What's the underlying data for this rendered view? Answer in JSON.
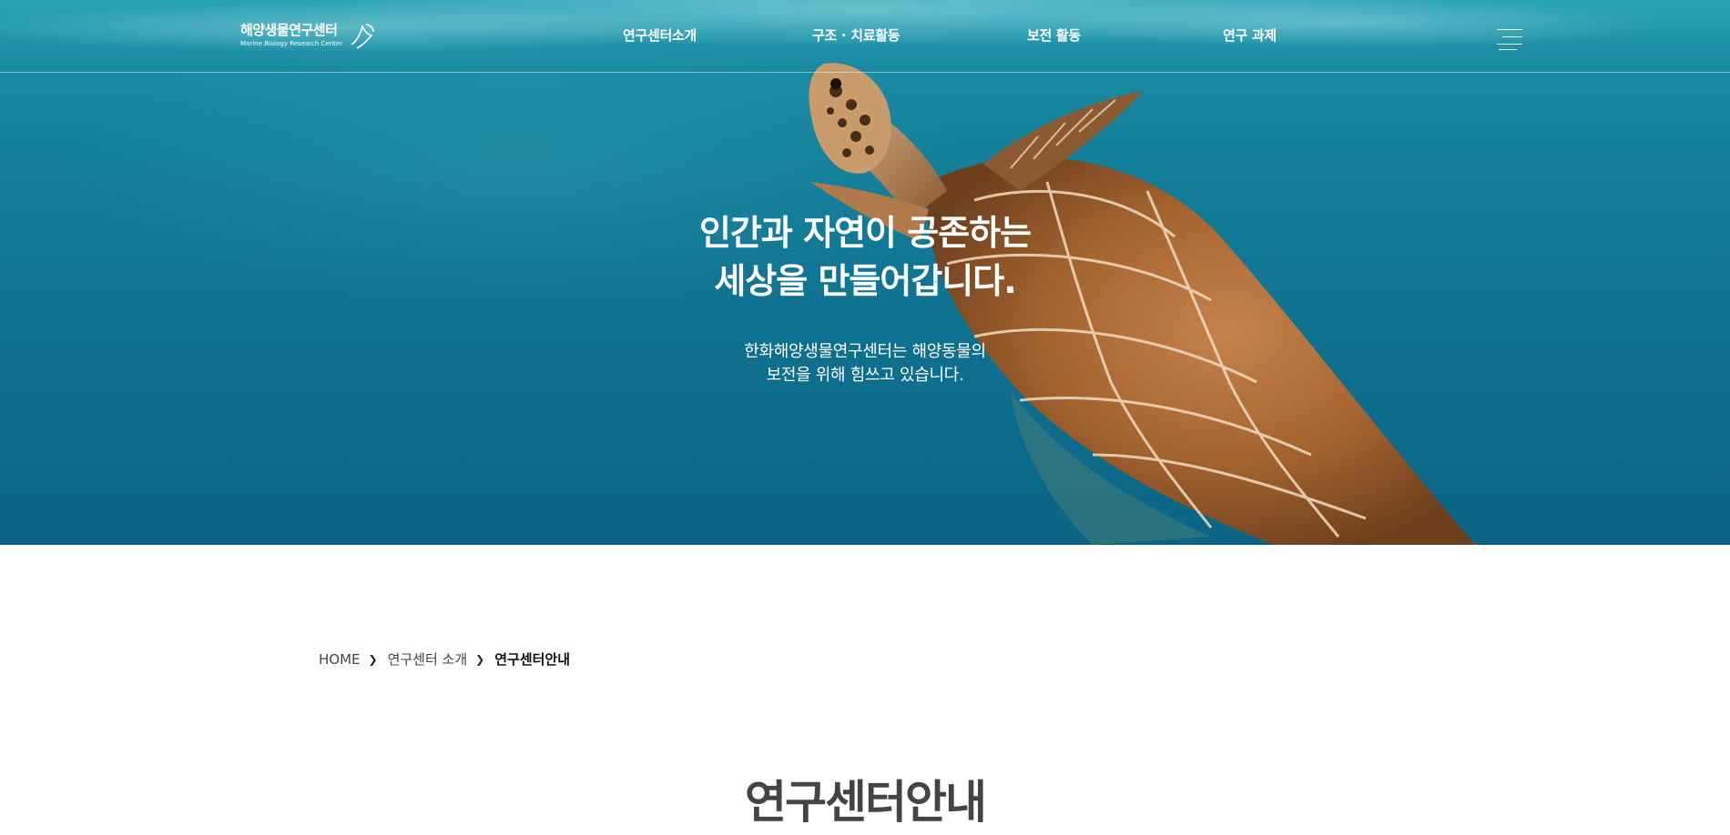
{
  "header": {
    "logo_text_ko": "해양생물연구센터",
    "logo_text_en": "Marine Biology Research Center",
    "nav": [
      {
        "label": "연구센터소개"
      },
      {
        "label": "구조 · 치료활동"
      },
      {
        "label": "보전 활동"
      },
      {
        "label": "연구 과제"
      }
    ],
    "menu_icon": "hamburger-menu-icon"
  },
  "hero": {
    "title_line1": "인간과 자연이 공존하는",
    "title_line2": "세상을 만들어갑니다.",
    "subtitle_line1": "한화해양생물연구센터는 해양동물의",
    "subtitle_line2": "보전을 위해 힘쓰고 있습니다."
  },
  "breadcrumb": {
    "items": [
      "HOME",
      "연구센터 소개",
      "연구센터안내"
    ],
    "separator": "❯"
  },
  "page": {
    "title": "연구센터안내"
  },
  "colors": {
    "ocean": "#137f99",
    "turtle_shell": "#a8683a",
    "text_dark": "#444444"
  }
}
